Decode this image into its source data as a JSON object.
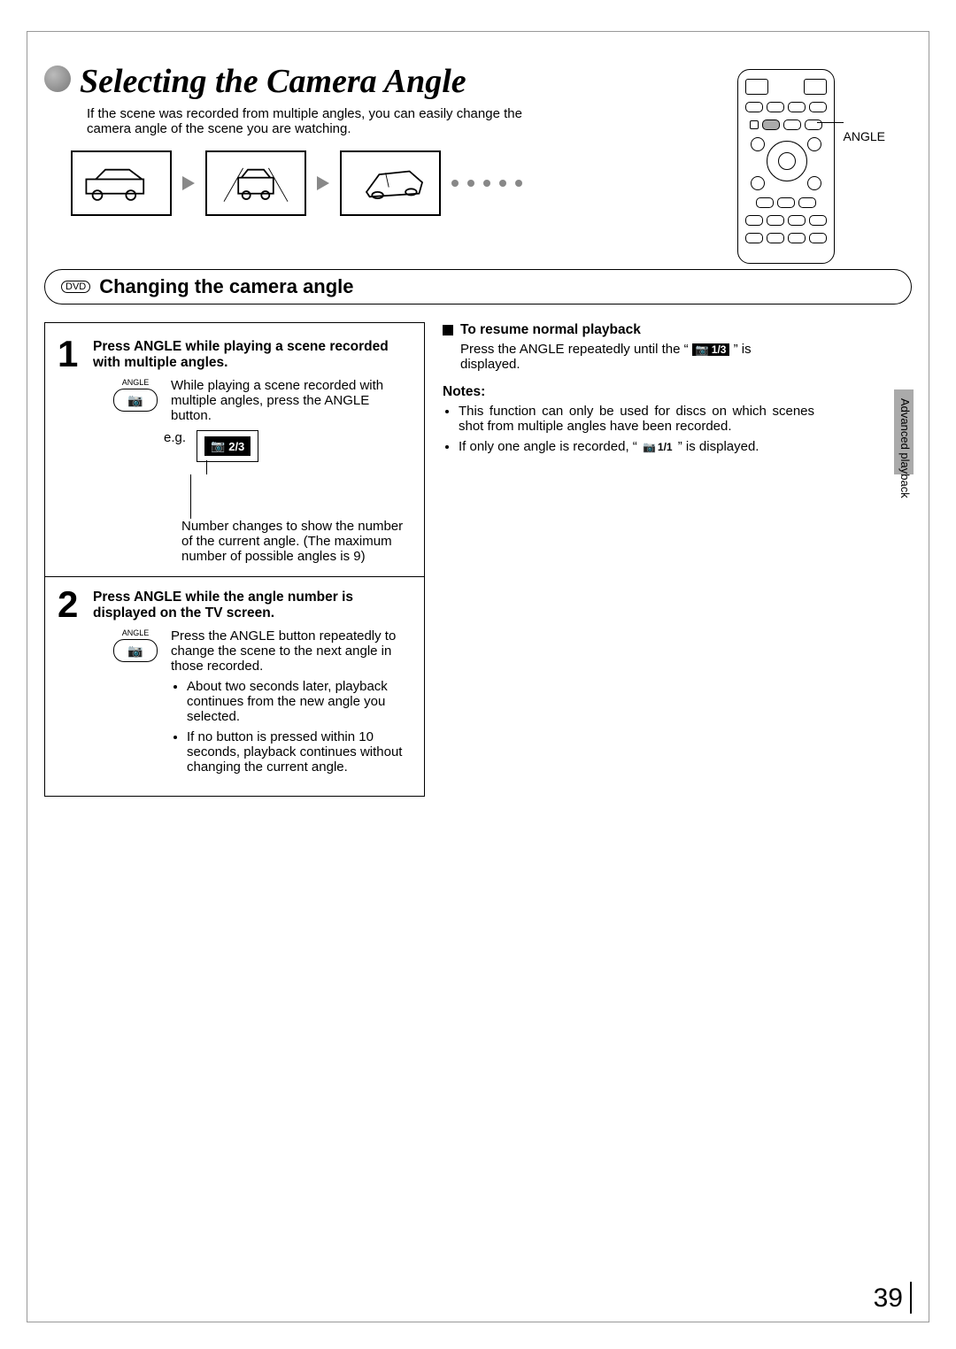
{
  "page": {
    "title": "Selecting the Camera Angle",
    "intro": "If the scene was recorded from multiple angles, you can easily change the camera angle of the scene you are watching.",
    "section_tab": "Advanced playback",
    "page_number": "39"
  },
  "remote": {
    "callout_label": "ANGLE"
  },
  "section": {
    "badge": "DVD",
    "title": "Changing the camera angle"
  },
  "steps": {
    "num1": "1",
    "head1": "Press ANGLE while playing a scene recorded with multiple angles.",
    "btn_label": "ANGLE",
    "body1": "While playing a scene recorded with multiple angles, press the ANGLE button.",
    "eg_label": "e.g.",
    "osd_icon": "📷",
    "osd_example": "2/3",
    "leader_note": "Number changes to show the number of the current angle. (The maximum number of possible angles is 9)",
    "num2": "2",
    "head2": "Press ANGLE while the angle number is displayed on the TV screen.",
    "body2": "Press the ANGLE button repeatedly to change the scene to the next angle in those recorded.",
    "bullet_a": "About two seconds later, playback continues from the new angle you selected.",
    "bullet_b": "If no button is pressed within 10 seconds, playback continues without changing the current angle."
  },
  "right": {
    "resume_head": "To resume normal playback",
    "resume_body_a": "Press the ANGLE repeatedly until the “ ",
    "resume_chip": "1/3",
    "resume_body_b": " ” is displayed.",
    "notes_head": "Notes:",
    "note1": "This function can only be used for discs on which scenes shot from multiple angles have been recorded.",
    "note2_a": "If only one angle is recorded, “ ",
    "note2_chip": "1/1",
    "note2_b": " ” is displayed."
  }
}
